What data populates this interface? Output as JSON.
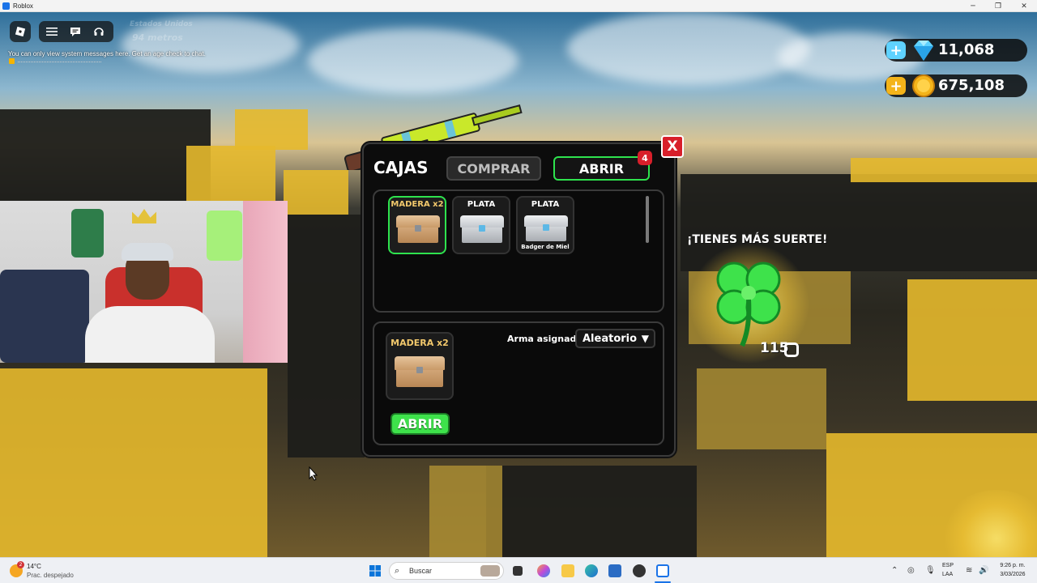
{
  "window": {
    "title": "Roblox",
    "controls": [
      "─",
      "❐",
      "✕"
    ]
  },
  "top_left": {
    "faded_name": "Estados Unidos",
    "faded_distance": "94 metros",
    "system_message": "You can only view system messages here. Get an age check to chat."
  },
  "currency": {
    "gems": "11,068",
    "coins": "675,108",
    "plus_label": "+"
  },
  "shop": {
    "title": "CAJAS",
    "tab_buy": "COMPRAR",
    "tab_open": "ABRIR",
    "tab_open_badge": "4",
    "close_label": "X",
    "inventory": [
      {
        "label": "MADERA x2",
        "subtitle": "",
        "selected": true,
        "type": "wood"
      },
      {
        "label": "PLATA",
        "subtitle": "",
        "selected": false,
        "type": "silver"
      },
      {
        "label": "PLATA",
        "subtitle": "Badger de Miel",
        "selected": false,
        "type": "silver"
      }
    ],
    "detail": {
      "label": "MADERA x2",
      "weapon_label": "Arma asignada",
      "dropdown_value": "Aleatorio",
      "dropdown_caret": "▼",
      "open_button": "ABRIR"
    }
  },
  "luck": {
    "title": "¡TIENES MÁS SUERTE!",
    "count": "115"
  },
  "taskbar": {
    "weather_temp": "14°C",
    "weather_desc": "Prac. despejado",
    "weather_badge": "2",
    "search_placeholder": "Buscar",
    "lang_top": "ESP",
    "lang_bottom": "LAA",
    "time": "9:26 p. m.",
    "date": "3/03/2026"
  },
  "colors": {
    "accent_green": "#2ee34e",
    "close_red": "#d81f2a",
    "gem_blue": "#5fd2ff",
    "coin_gold": "#f4b41a"
  }
}
